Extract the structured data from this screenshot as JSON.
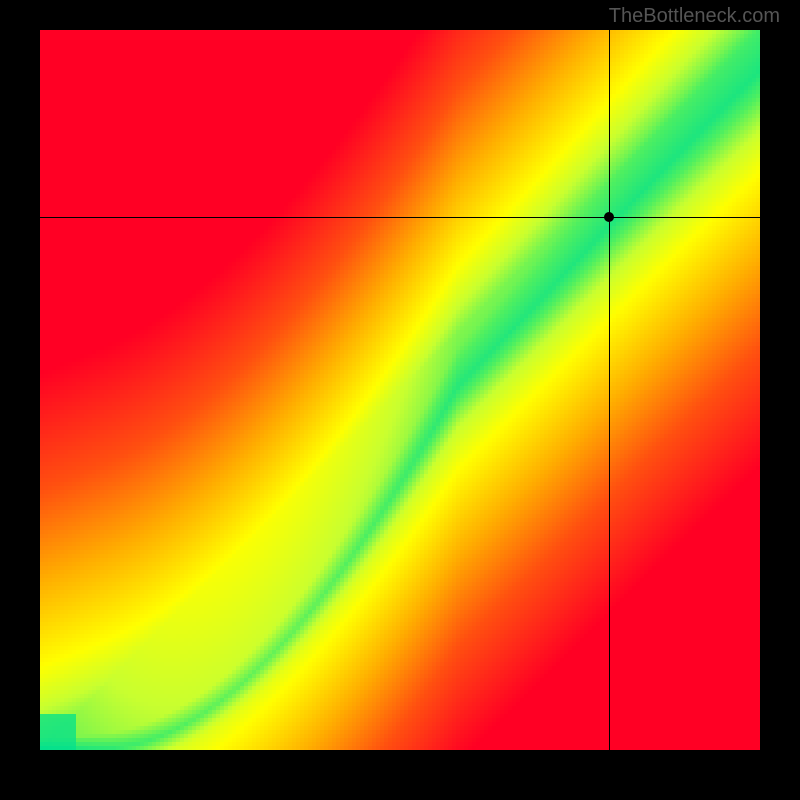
{
  "watermark": "TheBottleneck.com",
  "chart_data": {
    "type": "heatmap",
    "title": "",
    "xlabel": "",
    "ylabel": "",
    "xlim": [
      0,
      1
    ],
    "ylim": [
      0,
      1
    ],
    "marker": {
      "x": 0.79,
      "y": 0.74
    },
    "crosshair": {
      "x": 0.79,
      "y": 0.74
    },
    "description": "Bottleneck compatibility heatmap: green diagonal band represents optimal CPU/GPU pairing, red regions represent bottleneck, crosshair marks selected component pair",
    "color_scale": [
      "#ff0020",
      "#ff5010",
      "#ffb000",
      "#ffff00",
      "#80ff40",
      "#00e090"
    ],
    "optimal_band": {
      "center_curve_description": "Nonlinear curve from lower-left to upper-right passing roughly through (0,0) (0.1,0.03) (0.3,0.2) (0.5,0.45) (0.7,0.7) (0.9,0.88) (1.0,0.93)",
      "band_half_width_normalized": 0.06
    }
  }
}
